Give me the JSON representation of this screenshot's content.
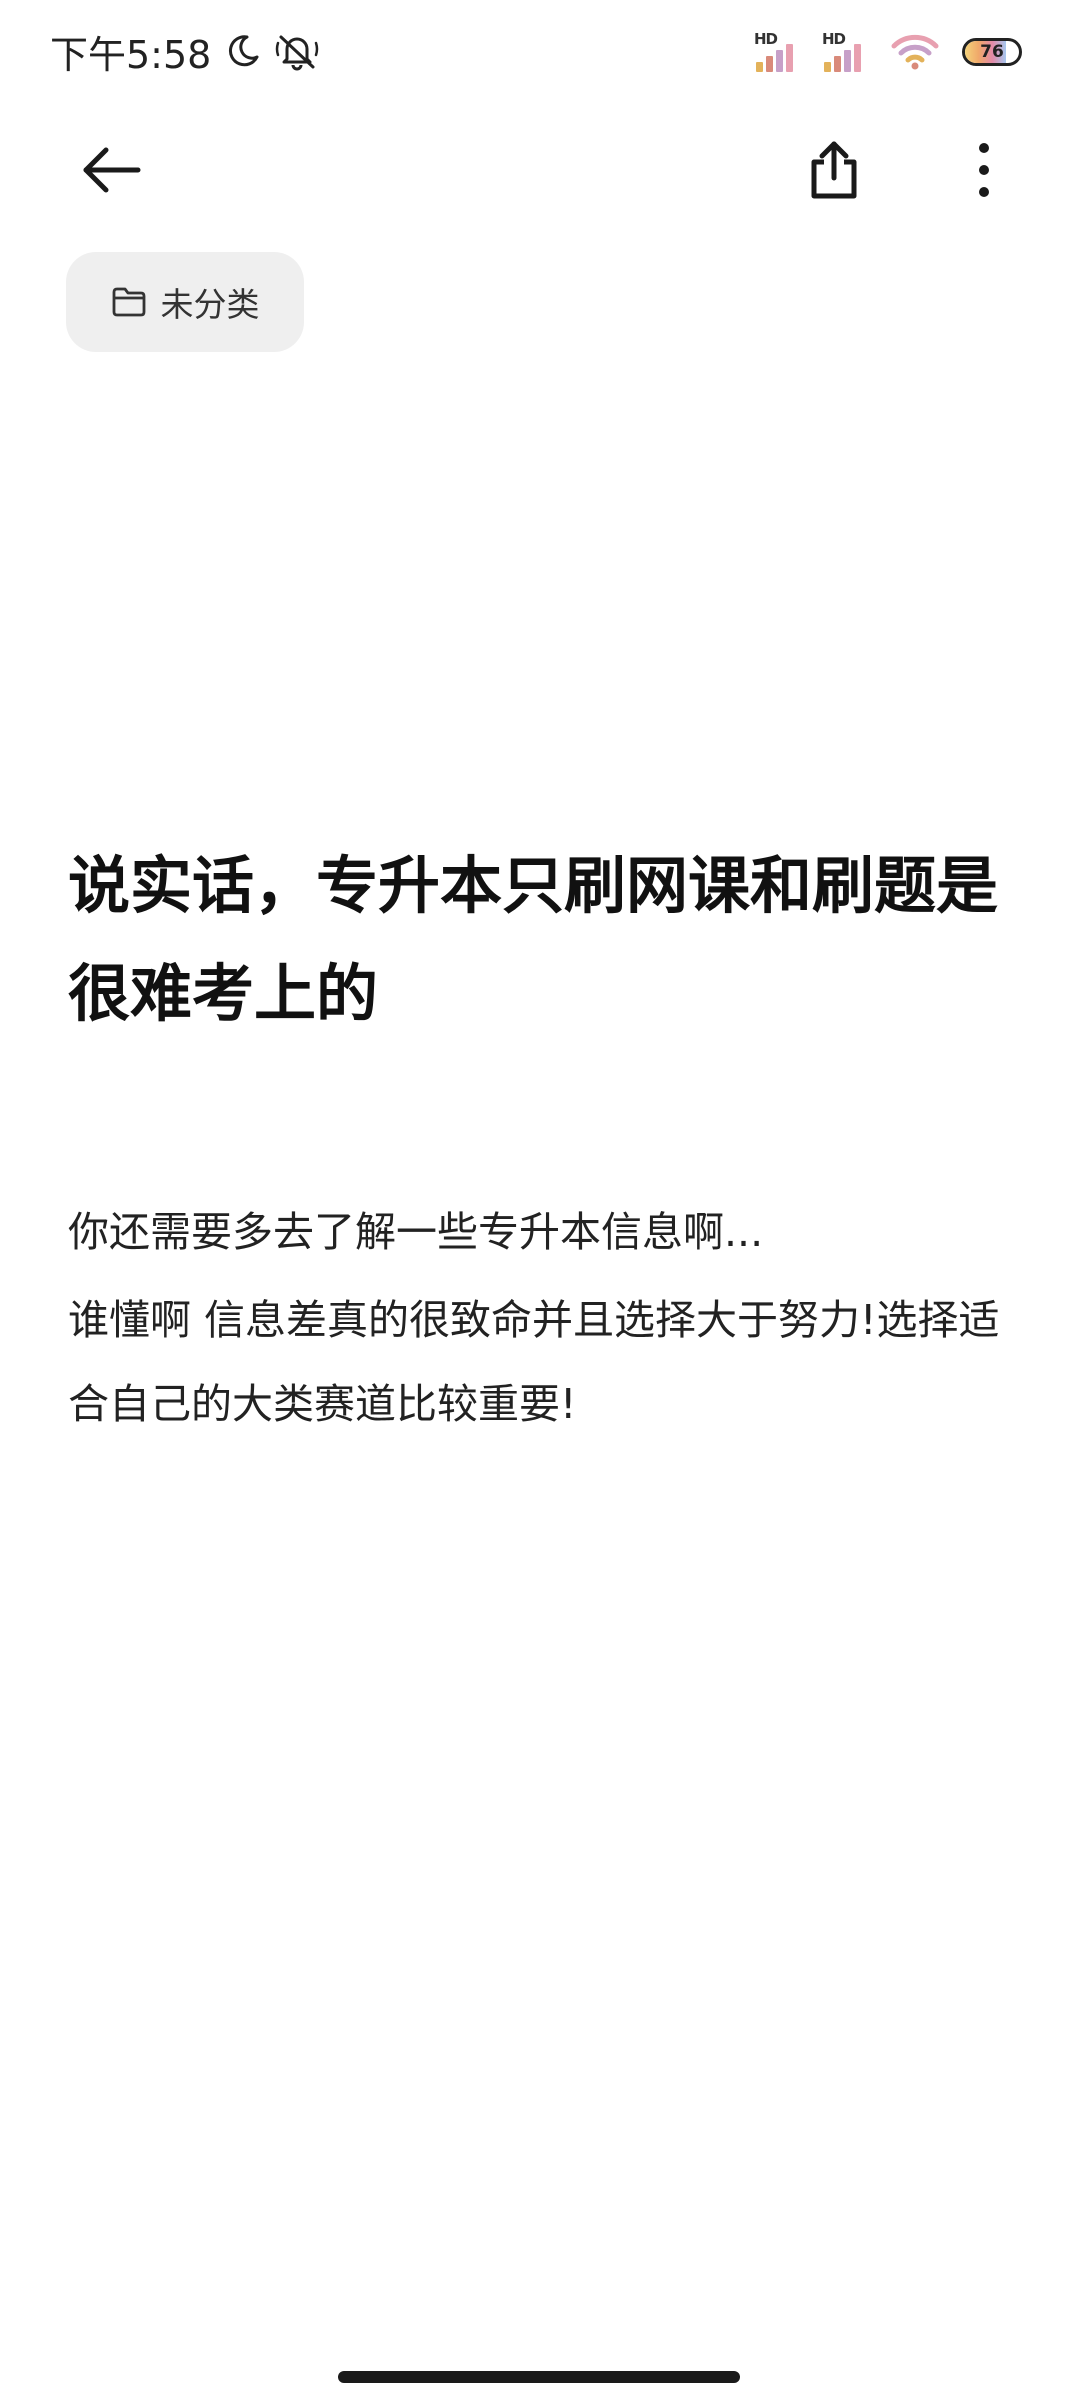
{
  "status_bar": {
    "time": "下午5:58",
    "sim1_label": "HD",
    "sim2_label": "HD",
    "battery_level": "76"
  },
  "toolbar": {
    "back_icon": "arrow-left-icon",
    "share_icon": "share-icon",
    "more_icon": "more-vertical-icon"
  },
  "folder": {
    "label": "未分类",
    "icon": "folder-icon"
  },
  "note": {
    "title": "说实话，专升本只刷网课和刷题是很难考上的",
    "paragraphs": [
      "你还需要多去了解一些专升本信息啊...",
      "谁懂啊 信息差真的很致命并且选择大于努力!选择适合自己的大类赛道比较重要!"
    ]
  },
  "colors": {
    "chip_background": "#efefef",
    "text_primary": "#111111",
    "home_indicator": "#1a1a1a"
  }
}
